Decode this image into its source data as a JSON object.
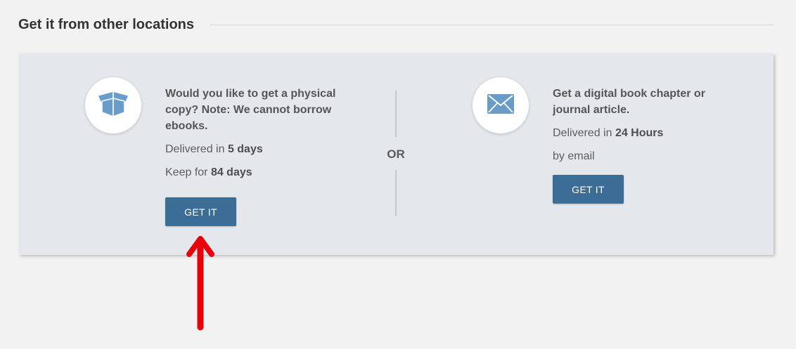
{
  "section": {
    "title": "Get it from other locations"
  },
  "physical": {
    "icon": "open-box-icon",
    "title_line1": "Would you like to get a physical",
    "title_line2": "copy? Note: We cannot borrow",
    "title_line3": "ebooks.",
    "delivered_prefix": "Delivered in",
    "delivered_value": "5 days",
    "keep_prefix": "Keep for",
    "keep_value": "84 days",
    "button_label": "GET IT"
  },
  "separator": {
    "label": "OR"
  },
  "digital": {
    "icon": "envelope-icon",
    "title_line1": "Get a digital book chapter or",
    "title_line2": "journal article.",
    "delivered_prefix": "Delivered in",
    "delivered_value": "24 Hours",
    "method": "by email",
    "button_label": "GET IT"
  },
  "annotation": {
    "arrow_color": "#e8000b"
  },
  "colors": {
    "button": "#3c6d97",
    "card_background": "#e4e8ec",
    "icon_blue": "#6a9cc9"
  }
}
